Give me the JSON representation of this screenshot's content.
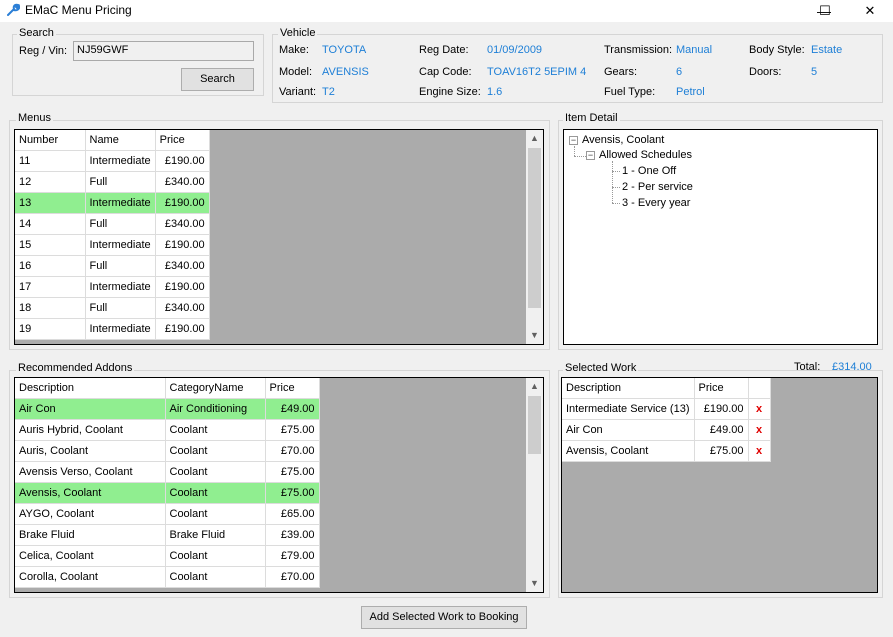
{
  "window": {
    "title": "EMaC Menu Pricing",
    "minimize": "—",
    "maximize": "☐",
    "close": "✕"
  },
  "search": {
    "group_label": "Search",
    "reg_label": "Reg / Vin:",
    "reg_value": "NJ59GWF",
    "button_label": "Search"
  },
  "vehicle": {
    "group_label": "Vehicle",
    "make_label": "Make:",
    "make": "TOYOTA",
    "model_label": "Model:",
    "model": "AVENSIS",
    "variant_label": "Variant:",
    "variant": "T2",
    "reg_date_label": "Reg Date:",
    "reg_date": "01/09/2009",
    "cap_code_label": "Cap Code:",
    "cap_code": "TOAV16T2 5EPIM 4",
    "engine_size_label": "Engine Size:",
    "engine_size": "1.6",
    "transmission_label": "Transmission:",
    "transmission": "Manual",
    "gears_label": "Gears:",
    "gears": "6",
    "fuel_type_label": "Fuel Type:",
    "fuel_type": "Petrol",
    "body_style_label": "Body Style:",
    "body_style": "Estate",
    "doors_label": "Doors:",
    "doors": "5"
  },
  "menus": {
    "group_label": "Menus",
    "columns": [
      "Number",
      "Name",
      "Price"
    ],
    "rows": [
      {
        "number": "11",
        "name": "Intermediate",
        "price": "£190.00",
        "selected": false
      },
      {
        "number": "12",
        "name": "Full",
        "price": "£340.00",
        "selected": false
      },
      {
        "number": "13",
        "name": "Intermediate",
        "price": "£190.00",
        "selected": true
      },
      {
        "number": "14",
        "name": "Full",
        "price": "£340.00",
        "selected": false
      },
      {
        "number": "15",
        "name": "Intermediate",
        "price": "£190.00",
        "selected": false
      },
      {
        "number": "16",
        "name": "Full",
        "price": "£340.00",
        "selected": false
      },
      {
        "number": "17",
        "name": "Intermediate",
        "price": "£190.00",
        "selected": false
      },
      {
        "number": "18",
        "name": "Full",
        "price": "£340.00",
        "selected": false
      },
      {
        "number": "19",
        "name": "Intermediate",
        "price": "£190.00",
        "selected": false
      }
    ]
  },
  "item_detail": {
    "group_label": "Item Detail",
    "root": "Avensis, Coolant",
    "child": "Allowed Schedules",
    "leaves": [
      "1 - One Off",
      "2 - Per service",
      "3 - Every year"
    ],
    "expander_symbol": "−"
  },
  "addons": {
    "group_label": "Recommended Addons",
    "columns": [
      "Description",
      "CategoryName",
      "Price"
    ],
    "rows": [
      {
        "description": "Air Con",
        "category": "Air Conditioning",
        "price": "£49.00",
        "selected": true
      },
      {
        "description": "Auris Hybrid, Coolant",
        "category": "Coolant",
        "price": "£75.00",
        "selected": false
      },
      {
        "description": "Auris, Coolant",
        "category": "Coolant",
        "price": "£70.00",
        "selected": false
      },
      {
        "description": "Avensis Verso, Coolant",
        "category": "Coolant",
        "price": "£75.00",
        "selected": false
      },
      {
        "description": "Avensis, Coolant",
        "category": "Coolant",
        "price": "£75.00",
        "selected": true
      },
      {
        "description": "AYGO, Coolant",
        "category": "Coolant",
        "price": "£65.00",
        "selected": false
      },
      {
        "description": "Brake Fluid",
        "category": "Brake Fluid",
        "price": "£39.00",
        "selected": false
      },
      {
        "description": "Celica, Coolant",
        "category": "Coolant",
        "price": "£79.00",
        "selected": false
      },
      {
        "description": "Corolla, Coolant",
        "category": "Coolant",
        "price": "£70.00",
        "selected": false
      }
    ]
  },
  "selected_work": {
    "group_label": "Selected Work",
    "total_label": "Total:",
    "total": "£314.00",
    "columns": [
      "Description",
      "Price",
      ""
    ],
    "rows": [
      {
        "description": "Intermediate Service (13)",
        "price": "£190.00",
        "remove": "x"
      },
      {
        "description": "Air Con",
        "price": "£49.00",
        "remove": "x"
      },
      {
        "description": "Avensis, Coolant",
        "price": "£75.00",
        "remove": "x"
      }
    ]
  },
  "footer": {
    "add_button": "Add Selected Work to Booking"
  },
  "scroll_arrows": {
    "up": "▲",
    "down": "▼"
  },
  "colors": {
    "accent_value": "#1e7fd6",
    "selected_row": "#90ee90",
    "remove": "#e00000",
    "grid_background": "#ababab"
  }
}
